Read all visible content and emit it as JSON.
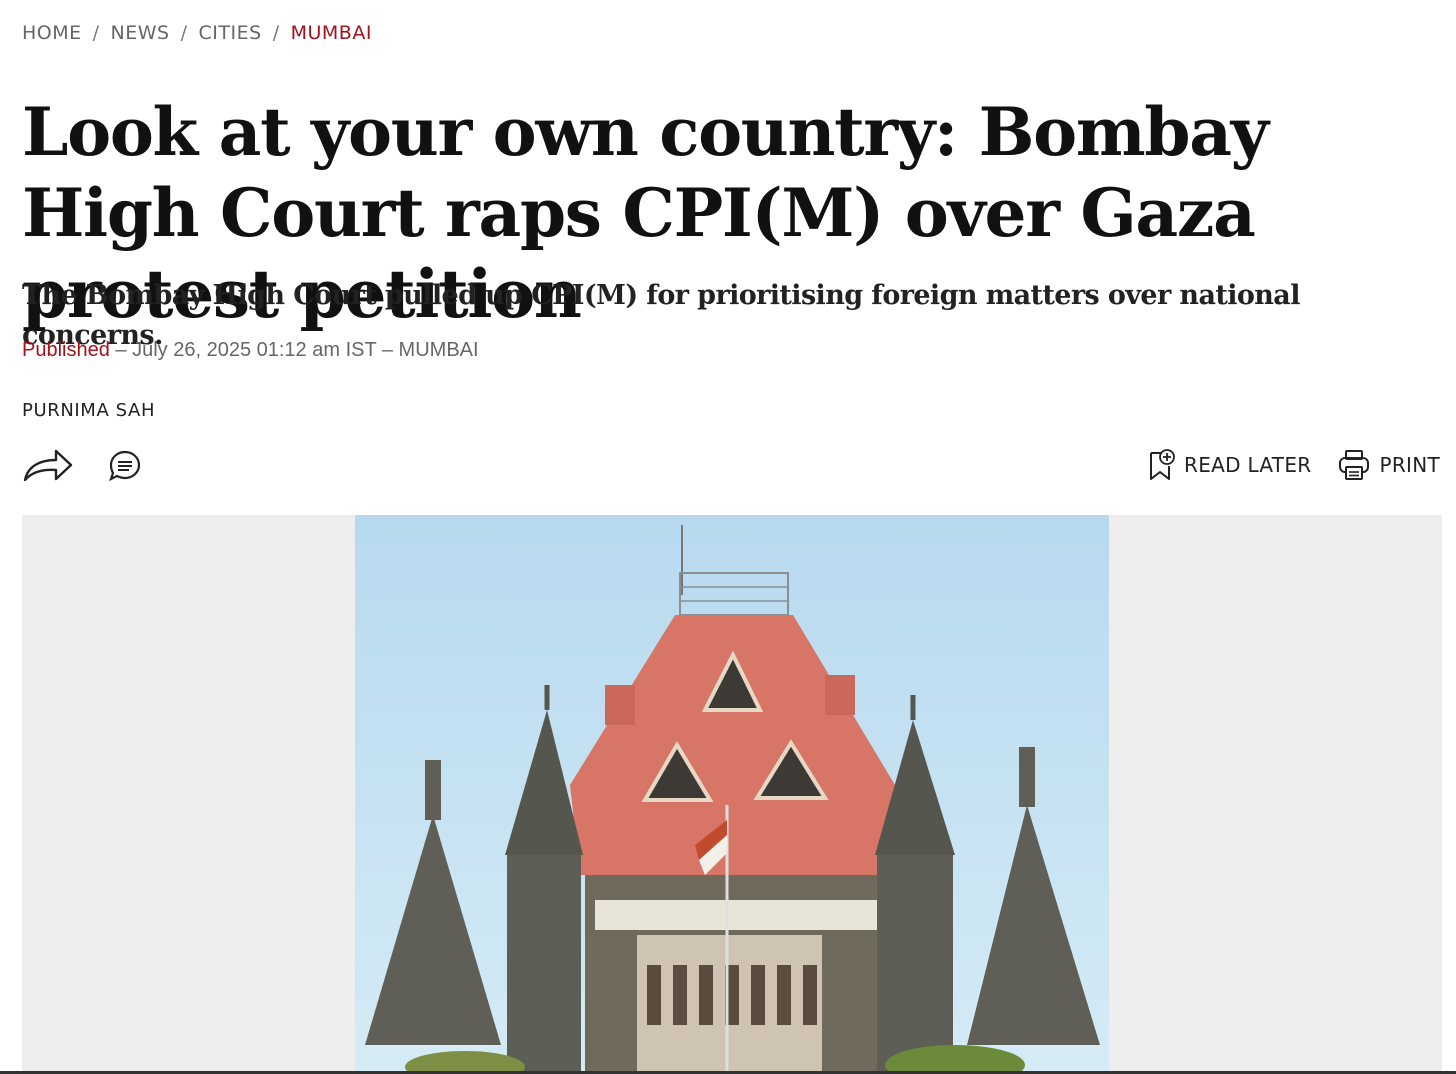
{
  "breadcrumb": {
    "items": [
      "HOME",
      "NEWS",
      "CITIES",
      "MUMBAI"
    ],
    "separator": "/",
    "current_color": "#a3111b"
  },
  "article": {
    "headline": "Look at your own country: Bombay High Court raps CPI(M) over Gaza protest petition",
    "subhead": "The Bombay High Court pulled up CPI(M) for prioritising foreign matters over national concerns.",
    "published_label": "Published",
    "published_detail": "– July 26, 2025 01:12 am IST – MUMBAI",
    "author": "PURNIMA SAH"
  },
  "toolbar": {
    "share_icon": "share-arrow-icon",
    "comment_icon": "comment-bubble-icon",
    "read_later_label": "READ LATER",
    "read_later_icon": "bookmark-plus-icon",
    "print_label": "PRINT",
    "print_icon": "printer-icon"
  },
  "hero_image": {
    "subject": "Bombay High Court building",
    "background_color": "#eeeeee"
  }
}
